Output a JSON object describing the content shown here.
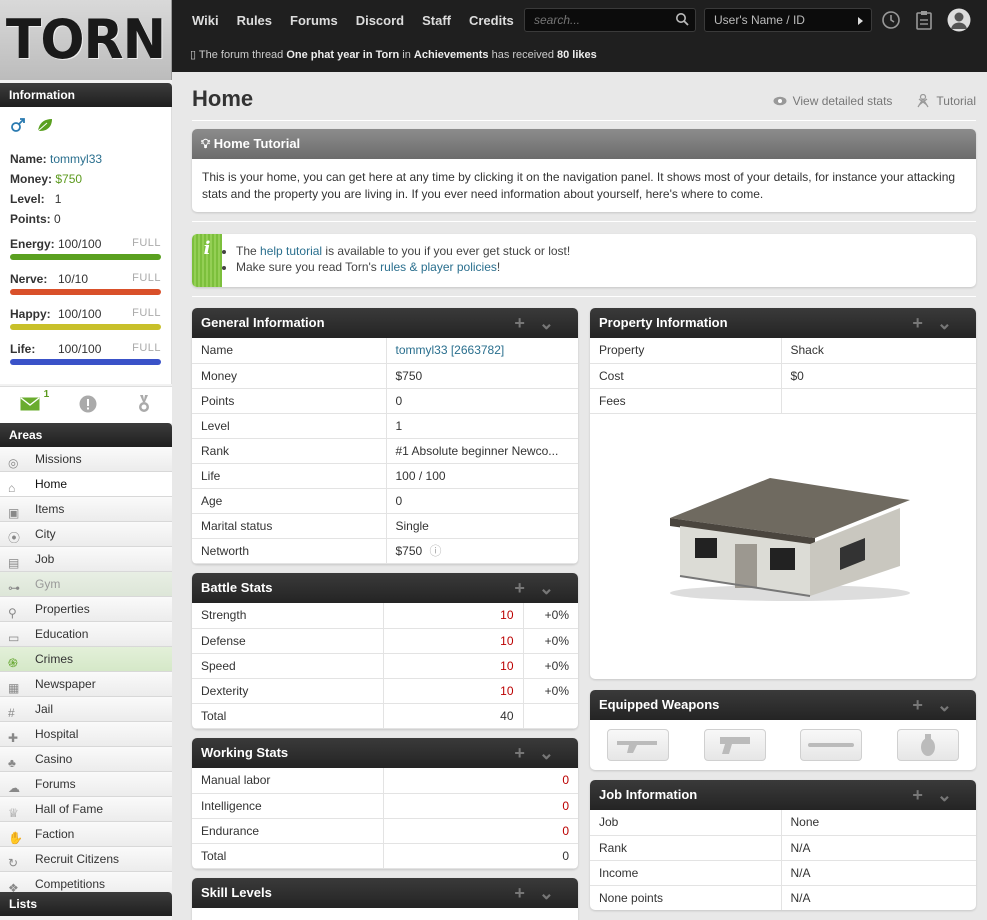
{
  "brand": {
    "logo": "TORN"
  },
  "header": {
    "nav": [
      "Wiki",
      "Rules",
      "Forums",
      "Discord",
      "Staff",
      "Credits"
    ],
    "search_placeholder": "search...",
    "user_placeholder": "User's Name / ID",
    "ticker_prefix": "The forum thread",
    "ticker_thread": "One phat year in Torn",
    "ticker_mid": "in",
    "ticker_forum": "Achievements",
    "ticker_suffix": "has received",
    "ticker_count": "80 likes"
  },
  "sidebar": {
    "info_title": "Information",
    "name_label": "Name:",
    "name_value": "tommyl33",
    "money_label": "Money:",
    "money_value": "$750",
    "level_label": "Level:",
    "level_value": "1",
    "points_label": "Points:",
    "points_value": "0",
    "bars": [
      {
        "label": "Energy:",
        "value": "100/100",
        "status": "FULL",
        "fill": 1.0,
        "color": "#5aa020"
      },
      {
        "label": "Nerve:",
        "value": "10/10",
        "status": "FULL",
        "fill": 1.0,
        "color": "#d9502a"
      },
      {
        "label": "Happy:",
        "value": "100/100",
        "status": "FULL",
        "fill": 1.0,
        "color": "#c8c02a"
      },
      {
        "label": "Life:",
        "value": "100/100",
        "status": "FULL",
        "fill": 1.0,
        "color": "#3a52c8"
      }
    ],
    "messages_count": "1",
    "areas_title": "Areas",
    "areas": [
      "Missions",
      "Home",
      "Items",
      "City",
      "Job",
      "Gym",
      "Properties",
      "Education",
      "Crimes",
      "Newspaper",
      "Jail",
      "Hospital",
      "Casino",
      "Forums",
      "Hall of Fame",
      "Faction",
      "Recruit Citizens",
      "Competitions"
    ],
    "lists_title": "Lists"
  },
  "main": {
    "title": "Home",
    "view_stats": "View detailed stats",
    "tutorial_link": "Tutorial",
    "tutorial": {
      "title": "Home Tutorial",
      "body": "This is your home, you can get here at any time by clicking it on the navigation panel. It shows most of your details, for instance your attacking stats and the property you are living in. If you ever need information about yourself, here's where to come."
    },
    "tips": {
      "line1_pre": "The",
      "line1_link": "help tutorial",
      "line1_post": "is available to you if you ever get stuck or lost!",
      "line2_pre": "Make sure you read Torn's",
      "line2_link": "rules & player policies",
      "line2_post": "!"
    },
    "general": {
      "title": "General Information",
      "rows": [
        [
          "Name",
          "tommyl33 [2663782]"
        ],
        [
          "Money",
          "$750"
        ],
        [
          "Points",
          "0"
        ],
        [
          "Level",
          "1"
        ],
        [
          "Rank",
          "#1 Absolute beginner Newco..."
        ],
        [
          "Life",
          "100 / 100"
        ],
        [
          "Age",
          "0"
        ],
        [
          "Marital status",
          "Single"
        ],
        [
          "Networth",
          "$750"
        ]
      ]
    },
    "battle": {
      "title": "Battle Stats",
      "rows": [
        [
          "Strength",
          "10",
          "+0%"
        ],
        [
          "Defense",
          "10",
          "+0%"
        ],
        [
          "Speed",
          "10",
          "+0%"
        ],
        [
          "Dexterity",
          "10",
          "+0%"
        ],
        [
          "Total",
          "40",
          ""
        ]
      ]
    },
    "working": {
      "title": "Working Stats",
      "rows": [
        [
          "Manual labor",
          "0"
        ],
        [
          "Intelligence",
          "0"
        ],
        [
          "Endurance",
          "0"
        ],
        [
          "Total",
          "0"
        ]
      ]
    },
    "skills": {
      "title": "Skill Levels"
    },
    "property": {
      "title": "Property Information",
      "rows": [
        [
          "Property",
          "Shack"
        ],
        [
          "Cost",
          "$0"
        ],
        [
          "Fees",
          ""
        ]
      ]
    },
    "weapons": {
      "title": "Equipped Weapons"
    },
    "job": {
      "title": "Job Information",
      "rows": [
        [
          "Job",
          "None"
        ],
        [
          "Rank",
          "N/A"
        ],
        [
          "Income",
          "N/A"
        ],
        [
          "None points",
          "N/A"
        ]
      ]
    }
  }
}
